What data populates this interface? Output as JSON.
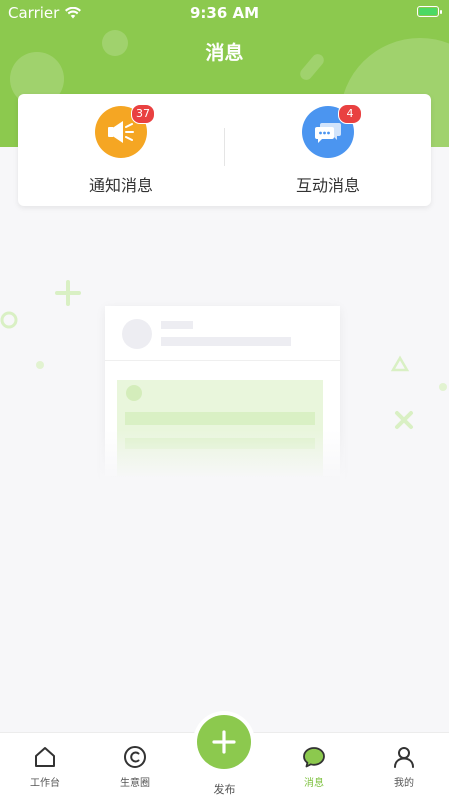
{
  "status_bar": {
    "carrier": "Carrier",
    "time": "9:36 AM"
  },
  "header": {
    "title": "消息"
  },
  "categories": [
    {
      "label": "通知消息",
      "badge": "37",
      "color": "#f5a623",
      "icon": "megaphone-icon"
    },
    {
      "label": "互动消息",
      "badge": "4",
      "color": "#4b95f0",
      "icon": "chat-bubbles-icon"
    }
  ],
  "tabbar": {
    "items": [
      {
        "label": "工作台",
        "icon": "home-icon"
      },
      {
        "label": "生意圈",
        "icon": "copyright-circle-icon"
      },
      {
        "label": "消息",
        "icon": "message-icon",
        "active": true
      },
      {
        "label": "我的",
        "icon": "person-icon"
      }
    ],
    "publish_label": "发布",
    "accent": "#8cc94e"
  }
}
